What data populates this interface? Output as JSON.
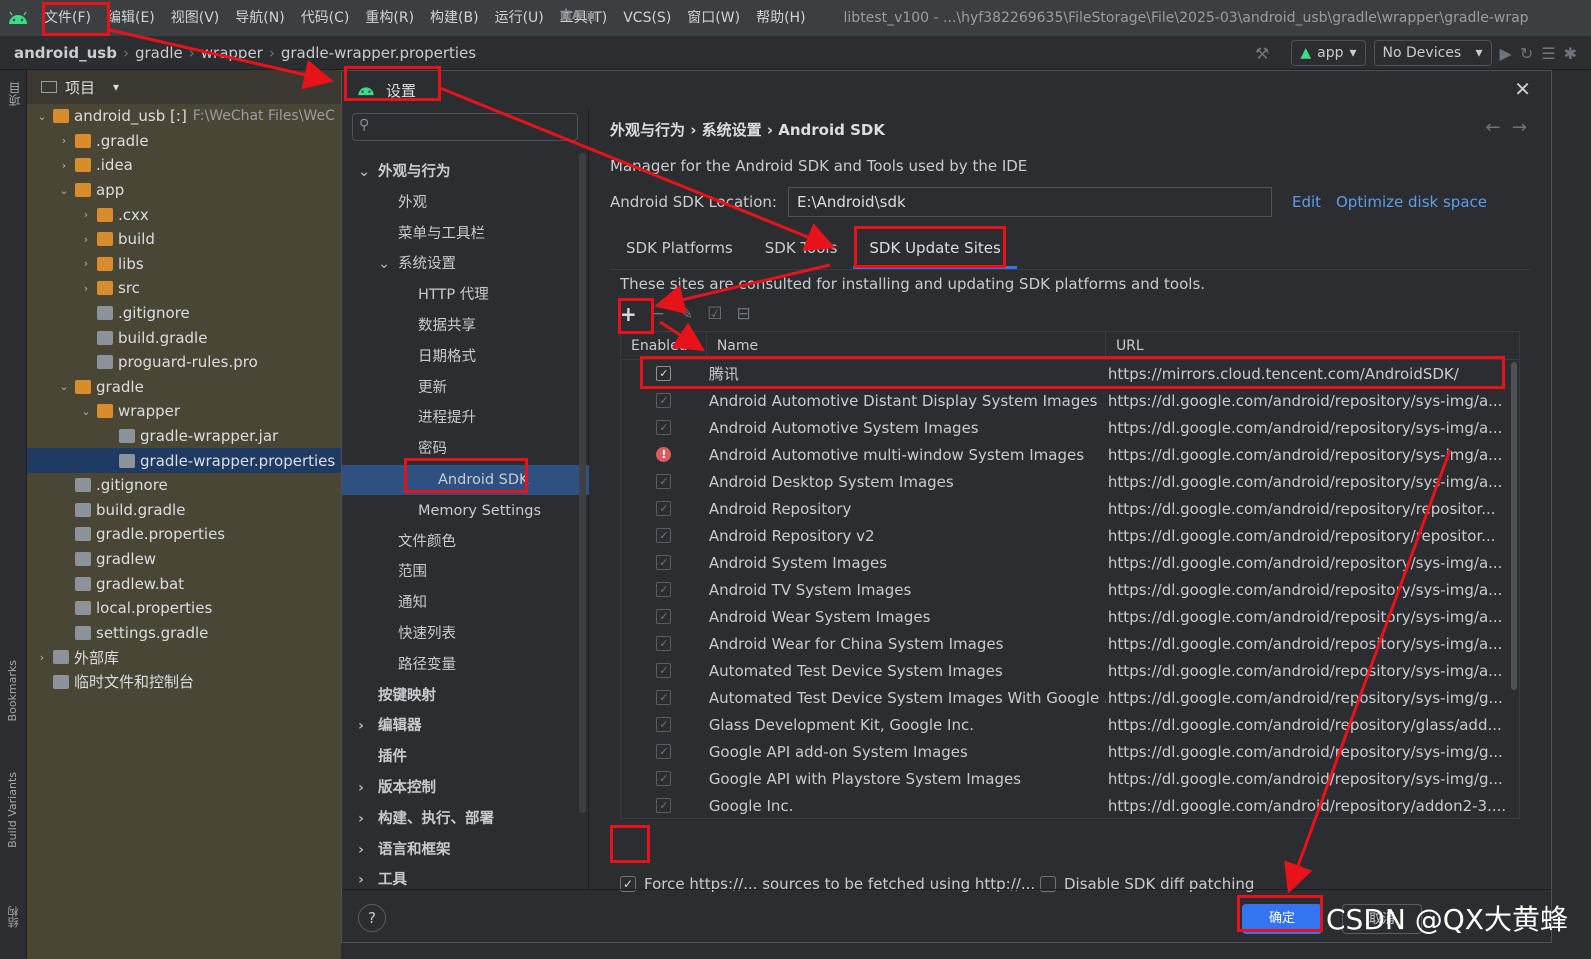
{
  "menubar": {
    "items": [
      "文件(F)",
      "编辑(E)",
      "视图(V)",
      "导航(N)",
      "代码(C)",
      "重构(R)",
      "构建(B)",
      "运行(U)",
      "工具(T)",
      "VCS(S)",
      "窗口(W)",
      "帮助(H)"
    ],
    "title": "libtest_v100 - ...\\hyf382269635\\FileStorage\\File\\2025-03\\android_usb\\gradle\\wrapper\\gradle-wrap"
  },
  "navbar": {
    "crumbs": [
      "android_usb",
      "gradle",
      "wrapper",
      "gradle-wrapper.properties"
    ],
    "run_config": "app",
    "device": "No Devices"
  },
  "leftstrip": {
    "project": "项目",
    "bookmarks": "Bookmarks",
    "build_variants": "Build Variants",
    "structure": "结构"
  },
  "project": {
    "header": "项目",
    "tree": [
      {
        "label": "android_usb [:]",
        "extra": "F:\\WeChat Files\\WeC",
        "indent": 0,
        "arrow": "v",
        "icon": "folder"
      },
      {
        "label": ".gradle",
        "indent": 1,
        "arrow": ">",
        "icon": "folder"
      },
      {
        "label": ".idea",
        "indent": 1,
        "arrow": ">",
        "icon": "folder"
      },
      {
        "label": "app",
        "indent": 1,
        "arrow": "v",
        "icon": "folder"
      },
      {
        "label": ".cxx",
        "indent": 2,
        "arrow": ">",
        "icon": "folder"
      },
      {
        "label": "build",
        "indent": 2,
        "arrow": ">",
        "icon": "folder"
      },
      {
        "label": "libs",
        "indent": 2,
        "arrow": ">",
        "icon": "folder"
      },
      {
        "label": "src",
        "indent": 2,
        "arrow": ">",
        "icon": "folder"
      },
      {
        "label": ".gitignore",
        "indent": 2,
        "arrow": "",
        "icon": "file"
      },
      {
        "label": "build.gradle",
        "indent": 2,
        "arrow": "",
        "icon": "file"
      },
      {
        "label": "proguard-rules.pro",
        "indent": 2,
        "arrow": "",
        "icon": "file"
      },
      {
        "label": "gradle",
        "indent": 1,
        "arrow": "v",
        "icon": "folder"
      },
      {
        "label": "wrapper",
        "indent": 2,
        "arrow": "v",
        "icon": "folder"
      },
      {
        "label": "gradle-wrapper.jar",
        "indent": 3,
        "arrow": "",
        "icon": "file"
      },
      {
        "label": "gradle-wrapper.properties",
        "indent": 3,
        "arrow": "",
        "icon": "file",
        "selected": true
      },
      {
        "label": ".gitignore",
        "indent": 1,
        "arrow": "",
        "icon": "file"
      },
      {
        "label": "build.gradle",
        "indent": 1,
        "arrow": "",
        "icon": "file"
      },
      {
        "label": "gradle.properties",
        "indent": 1,
        "arrow": "",
        "icon": "file"
      },
      {
        "label": "gradlew",
        "indent": 1,
        "arrow": "",
        "icon": "file"
      },
      {
        "label": "gradlew.bat",
        "indent": 1,
        "arrow": "",
        "icon": "file"
      },
      {
        "label": "local.properties",
        "indent": 1,
        "arrow": "",
        "icon": "file"
      },
      {
        "label": "settings.gradle",
        "indent": 1,
        "arrow": "",
        "icon": "file"
      },
      {
        "label": "外部库",
        "indent": 0,
        "arrow": ">",
        "icon": "file"
      },
      {
        "label": "临时文件和控制台",
        "indent": 0,
        "arrow": "",
        "icon": "file"
      }
    ]
  },
  "dialog": {
    "title": "设置",
    "settings_nav": [
      {
        "label": "外观与行为",
        "bold": true,
        "indent": 0,
        "arrow": "v"
      },
      {
        "label": "外观",
        "indent": 1
      },
      {
        "label": "菜单与工具栏",
        "indent": 1
      },
      {
        "label": "系统设置",
        "indent": 1,
        "arrow": "v"
      },
      {
        "label": "HTTP 代理",
        "indent": 2
      },
      {
        "label": "数据共享",
        "indent": 2
      },
      {
        "label": "日期格式",
        "indent": 2
      },
      {
        "label": "更新",
        "indent": 2
      },
      {
        "label": "进程提升",
        "indent": 2
      },
      {
        "label": "密码",
        "indent": 2
      },
      {
        "label": "Android SDK",
        "indent": 2,
        "selected": true
      },
      {
        "label": "Memory Settings",
        "indent": 2
      },
      {
        "label": "文件颜色",
        "indent": 1,
        "glyph": "▣"
      },
      {
        "label": "范围",
        "indent": 1,
        "glyph": "▣"
      },
      {
        "label": "通知",
        "indent": 1
      },
      {
        "label": "快速列表",
        "indent": 1
      },
      {
        "label": "路径变量",
        "indent": 1
      },
      {
        "label": "按键映射",
        "bold": true,
        "indent": 0
      },
      {
        "label": "编辑器",
        "bold": true,
        "indent": 0,
        "arrow": ">"
      },
      {
        "label": "插件",
        "bold": true,
        "indent": 0,
        "glyph": "文A ▣"
      },
      {
        "label": "版本控制",
        "bold": true,
        "indent": 0,
        "arrow": ">",
        "glyph": "▣"
      },
      {
        "label": "构建、执行、部署",
        "bold": true,
        "indent": 0,
        "arrow": ">"
      },
      {
        "label": "语言和框架",
        "bold": true,
        "indent": 0,
        "arrow": ">"
      },
      {
        "label": "工具",
        "bold": true,
        "indent": 0,
        "arrow": ">"
      }
    ],
    "breadcrumb": "外观与行为  ›  系统设置  ›  Android SDK",
    "description": "Manager for the Android SDK and Tools used by the IDE",
    "location_label": "Android SDK Location:",
    "location_value": "E:\\Android\\sdk",
    "edit_link": "Edit",
    "optimize_link": "Optimize disk space",
    "tabs": [
      "SDK Platforms",
      "SDK Tools",
      "SDK Update Sites"
    ],
    "active_tab": 2,
    "hint": "These sites are consulted for installing and updating SDK platforms and tools.",
    "columns": [
      "Enabled",
      "Name",
      "URL"
    ],
    "rows": [
      {
        "enabled": "on",
        "name": "腾讯",
        "url": "https://mirrors.cloud.tencent.com/AndroidSDK/"
      },
      {
        "enabled": "dim",
        "name": "Android Automotive Distant Display System Images",
        "url": "https://dl.google.com/android/repository/sys-img/a..."
      },
      {
        "enabled": "dim",
        "name": "Android Automotive System Images",
        "url": "https://dl.google.com/android/repository/sys-img/a..."
      },
      {
        "enabled": "error",
        "name": "Android Automotive multi-window System Images",
        "url": "https://dl.google.com/android/repository/sys-img/a..."
      },
      {
        "enabled": "dim",
        "name": "Android Desktop System Images",
        "url": "https://dl.google.com/android/repository/sys-img/a..."
      },
      {
        "enabled": "dim",
        "name": "Android Repository",
        "url": "https://dl.google.com/android/repository/repositor..."
      },
      {
        "enabled": "dim",
        "name": "Android Repository v2",
        "url": "https://dl.google.com/android/repository/repositor..."
      },
      {
        "enabled": "dim",
        "name": "Android System Images",
        "url": "https://dl.google.com/android/repository/sys-img/a..."
      },
      {
        "enabled": "dim",
        "name": "Android TV System Images",
        "url": "https://dl.google.com/android/repository/sys-img/a..."
      },
      {
        "enabled": "dim",
        "name": "Android Wear System Images",
        "url": "https://dl.google.com/android/repository/sys-img/a..."
      },
      {
        "enabled": "dim",
        "name": "Android Wear for China System Images",
        "url": "https://dl.google.com/android/repository/sys-img/a..."
      },
      {
        "enabled": "dim",
        "name": "Automated Test Device System Images",
        "url": "https://dl.google.com/android/repository/sys-img/a..."
      },
      {
        "enabled": "dim",
        "name": "Automated Test Device System Images With Google ...",
        "url": "https://dl.google.com/android/repository/sys-img/g..."
      },
      {
        "enabled": "dim",
        "name": "Glass Development Kit, Google Inc.",
        "url": "https://dl.google.com/android/repository/glass/add..."
      },
      {
        "enabled": "dim",
        "name": "Google API add-on System Images",
        "url": "https://dl.google.com/android/repository/sys-img/g..."
      },
      {
        "enabled": "dim",
        "name": "Google API with Playstore System Images",
        "url": "https://dl.google.com/android/repository/sys-img/g..."
      },
      {
        "enabled": "dim",
        "name": "Google Inc.",
        "url": "https://dl.google.com/android/repository/addon2-3...."
      }
    ],
    "force_https_label": "Force https://... sources to be fetched using http://...",
    "force_https_checked": true,
    "disable_diff_label": "Disable SDK diff patching",
    "disable_diff_checked": false,
    "ok_label": "确定",
    "cancel_label": "取消",
    "help_label": "?"
  },
  "watermark": "CSDN @QX大黄蜂",
  "colors": {
    "annotation": "#e8121b",
    "accent": "#3574f0",
    "selection": "#2e5182"
  }
}
